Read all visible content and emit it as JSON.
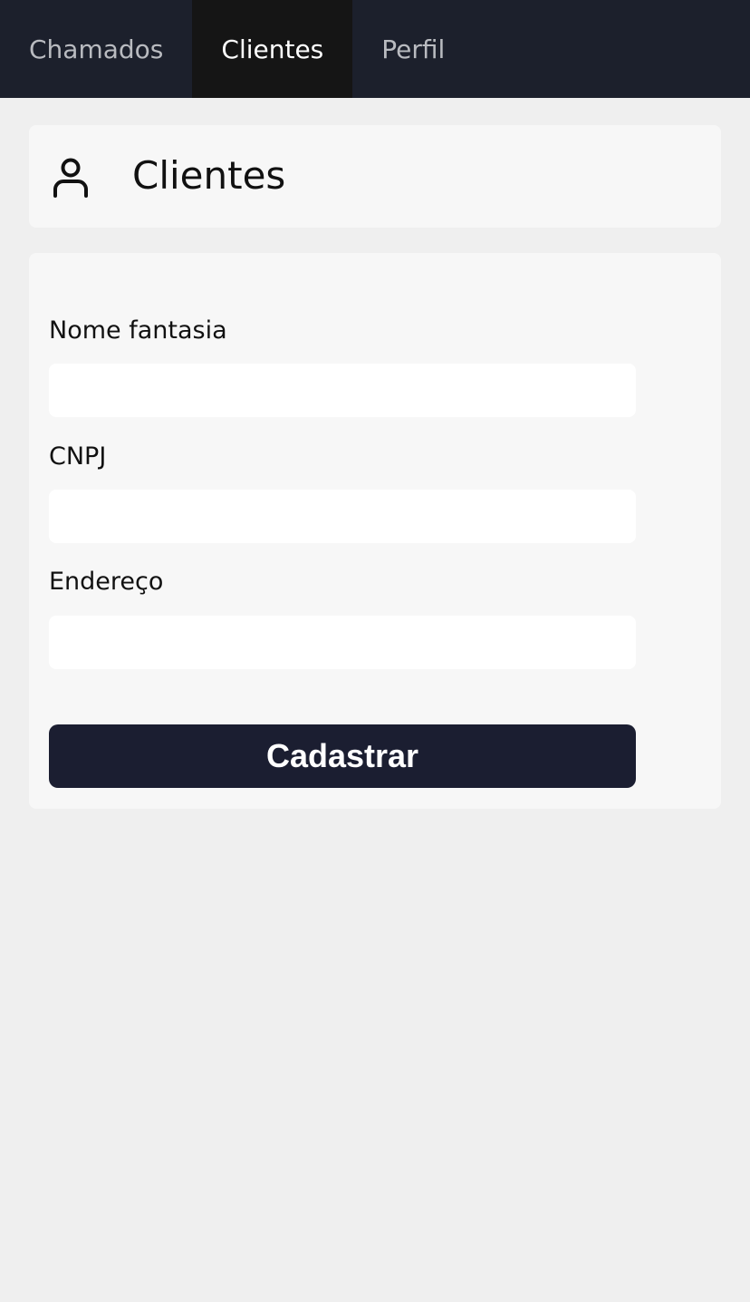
{
  "nav": {
    "tabs": [
      {
        "label": "Chamados",
        "active": false
      },
      {
        "label": "Clientes",
        "active": true
      },
      {
        "label": "Perfil",
        "active": false
      }
    ]
  },
  "header": {
    "icon": "user-icon",
    "title": "Clientes"
  },
  "form": {
    "fields": [
      {
        "label": "Nome fantasia",
        "value": "",
        "placeholder": ""
      },
      {
        "label": "CNPJ",
        "value": "",
        "placeholder": ""
      },
      {
        "label": "Endereço",
        "value": "",
        "placeholder": ""
      }
    ],
    "submit_label": "Cadastrar"
  },
  "colors": {
    "nav_background": "#1c202c",
    "nav_active": "#151515",
    "page_background": "#efefef",
    "card_background": "#f7f7f7",
    "button_background": "#1b1e31"
  }
}
